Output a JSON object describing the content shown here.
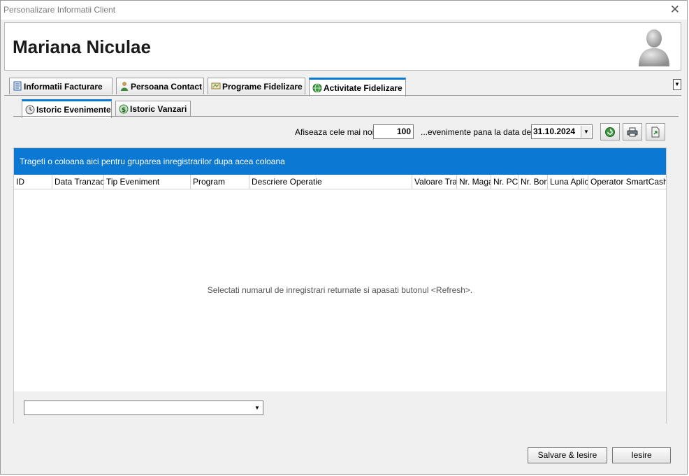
{
  "window": {
    "title": "Personalizare Informatii Client",
    "close_symbol": "✕"
  },
  "client": {
    "name": "Mariana Niculae"
  },
  "main_tabs": [
    {
      "label": "Informatii Facturare",
      "icon": "invoice-icon"
    },
    {
      "label": "Persoana Contact",
      "icon": "contact-person-icon"
    },
    {
      "label": "Programe Fidelizare",
      "icon": "loyalty-card-icon"
    },
    {
      "label": "Activitate Fidelizare",
      "icon": "globe-icon",
      "active": true
    }
  ],
  "sub_tabs": [
    {
      "label": "Istoric Evenimente",
      "icon": "events-history-icon",
      "active": true
    },
    {
      "label": "Istoric Vanzari",
      "icon": "sales-history-icon"
    }
  ],
  "toolbar": {
    "show_label": "Afiseaza cele mai noi",
    "count_value": "100",
    "events_label": "...evenimente pana la data de",
    "date_value": "31.10.2024"
  },
  "grid": {
    "group_hint": "Trageti o coloana aici pentru gruparea inregistrarilor dupa acea coloana",
    "columns": [
      "ID",
      "Data Tranzactie",
      "Tip Eveniment",
      "Program",
      "Descriere Operatie",
      "Valoare Tranzactie",
      "Nr. Magazin",
      "Nr. PC",
      "Nr. Bon",
      "Luna Aplicare",
      "Operator SmartCash"
    ],
    "empty_message": "Selectati numarul de inregistrari returnate si apasati butonul <Refresh>.",
    "combo_value": ""
  },
  "buttons": {
    "save_exit": "Salvare & Iesire",
    "exit": "Iesire"
  },
  "colors": {
    "accent": "#0b78d4",
    "background": "#f0f0f0"
  }
}
